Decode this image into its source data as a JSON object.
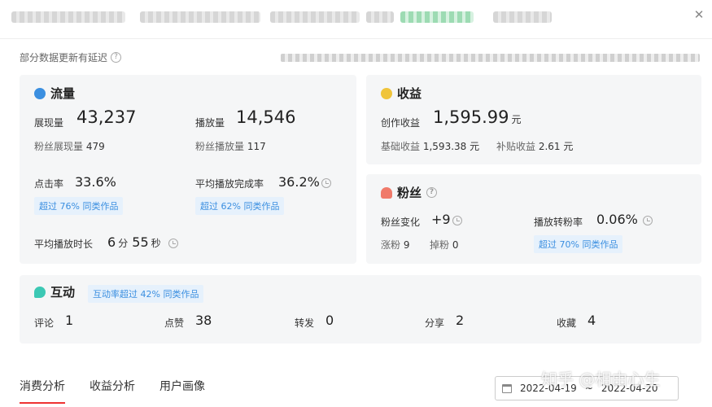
{
  "notice": {
    "text": "部分数据更新有延迟"
  },
  "traffic": {
    "title": "流量",
    "impressions_label": "展现量",
    "impressions": "43,237",
    "plays_label": "播放量",
    "plays": "14,546",
    "fan_impressions_label": "粉丝展现量",
    "fan_impressions": "479",
    "fan_plays_label": "粉丝播放量",
    "fan_plays": "117",
    "ctr_label": "点击率",
    "ctr": "33.6%",
    "ctr_badge": "超过 76% 同类作品",
    "completion_label": "平均播放完成率",
    "completion": "36.2%",
    "completion_badge": "超过 62% 同类作品",
    "duration_label": "平均播放时长",
    "duration_min": "6",
    "min_unit": "分",
    "duration_sec": "55",
    "sec_unit": "秒"
  },
  "earnings": {
    "title": "收益",
    "creation_label": "创作收益",
    "creation": "1,595.99",
    "unit": "元",
    "base_label": "基础收益",
    "base": "1,593.38 元",
    "subsidy_label": "补贴收益",
    "subsidy": "2.61 元"
  },
  "fans": {
    "title": "粉丝",
    "change_label": "粉丝变化",
    "change": "+9",
    "conversion_label": "播放转粉率",
    "conversion": "0.06%",
    "conversion_badge": "超过 70% 同类作品",
    "gain_label": "涨粉",
    "gain": "9",
    "loss_label": "掉粉",
    "loss": "0"
  },
  "interaction": {
    "title": "互动",
    "badge": "互动率超过 42% 同类作品",
    "comments_label": "评论",
    "comments": "1",
    "likes_label": "点赞",
    "likes": "38",
    "shares_label": "转发",
    "shares": "0",
    "forward_label": "分享",
    "forward": "2",
    "favorites_label": "收藏",
    "favorites": "4"
  },
  "tabs": [
    "消费分析",
    "收益分析",
    "用户画像"
  ],
  "date_range": {
    "start": "2022-04-19",
    "sep": "~",
    "end": "2022-04-20"
  },
  "watermark": "知乎 @相由心生",
  "colors": {
    "accent_red": "#e33333",
    "badge_blue": "#3b8fe0",
    "card_bg": "#f5f6f7"
  },
  "icons": {
    "traffic": "drop-icon",
    "earnings": "coin-icon",
    "fans": "person-icon",
    "interaction": "chat-bubble-icon"
  }
}
